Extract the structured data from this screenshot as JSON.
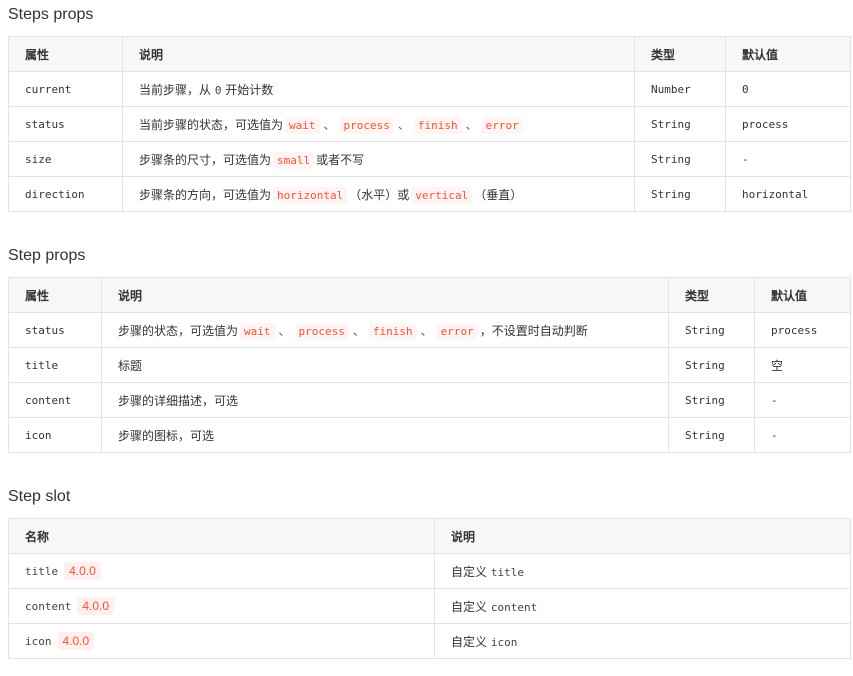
{
  "steps_props": {
    "title": "Steps props",
    "headers": [
      "属性",
      "说明",
      "类型",
      "默认值"
    ],
    "rows": [
      {
        "name": "current",
        "desc": [
          "当前步骤，从 ",
          "0",
          " 开始计数"
        ],
        "type": "Number",
        "default": "0"
      },
      {
        "name": "status",
        "desc_prefix": "当前步骤的状态，可选值为",
        "codes": [
          "wait",
          "process",
          "finish",
          "error"
        ],
        "separator": "、",
        "type": "String",
        "default": "process"
      },
      {
        "name": "size",
        "desc_prefix": "步骤条的尺寸，可选值为",
        "code": "small",
        "desc_suffix": "或者不写",
        "type": "String",
        "default": "-"
      },
      {
        "name": "direction",
        "desc_prefix": "步骤条的方向，可选值为",
        "code1": "horizontal",
        "mid": "（水平）或",
        "code2": "vertical",
        "desc_suffix": "（垂直）",
        "type": "String",
        "default": "horizontal"
      }
    ]
  },
  "step_props": {
    "title": "Step props",
    "headers": [
      "属性",
      "说明",
      "类型",
      "默认值"
    ],
    "rows": [
      {
        "name": "status",
        "desc_prefix": "步骤的状态，可选值为",
        "codes": [
          "wait",
          "process",
          "finish",
          "error"
        ],
        "separator": "、",
        "desc_suffix": "，不设置时自动判断",
        "type": "String",
        "default": "process"
      },
      {
        "name": "title",
        "desc": "标题",
        "type": "String",
        "default": "空"
      },
      {
        "name": "content",
        "desc": "步骤的详细描述，可选",
        "type": "String",
        "default": "-"
      },
      {
        "name": "icon",
        "desc": "步骤的图标，可选",
        "type": "String",
        "default": "-"
      }
    ]
  },
  "step_slot": {
    "title": "Step slot",
    "headers": [
      "名称",
      "说明"
    ],
    "rows": [
      {
        "name": "title",
        "version": "4.0.0",
        "desc_prefix": "自定义 ",
        "desc_code": "title"
      },
      {
        "name": "content",
        "version": "4.0.0",
        "desc_prefix": "自定义 ",
        "desc_code": "content"
      },
      {
        "name": "icon",
        "version": "4.0.0",
        "desc_prefix": "自定义 ",
        "desc_code": "icon"
      }
    ]
  },
  "colors": {
    "code_text": "#ff502c",
    "code_bg": "#fff5f5",
    "header_bg": "#f7f7f7",
    "border": "#e3e3e3"
  }
}
